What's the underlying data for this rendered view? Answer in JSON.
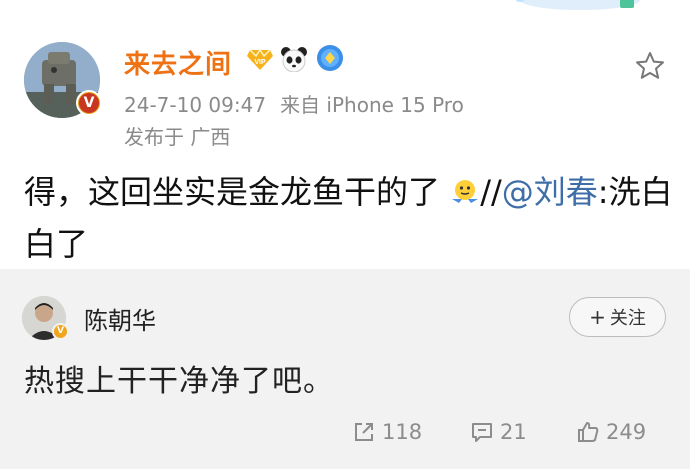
{
  "post": {
    "username": "来去之间",
    "timestamp": "24-7-10 09:47",
    "source": "来自 iPhone 15 Pro",
    "location": "发布于 广西",
    "text_main": "得，这回坐实是金龙鱼干的了",
    "text_slashes": "//",
    "mention": "@刘春",
    "text_tail": ":洗白白了",
    "emoji": "shrug-face-icon"
  },
  "repost": {
    "username": "陈朝华",
    "follow_label": "关注",
    "follow_plus": "+",
    "text": "热搜上干干净净了吧。",
    "repost_count": "118",
    "comment_count": "21",
    "like_count": "249"
  },
  "colors": {
    "username": "#ee7214",
    "mention": "#3e6ea8",
    "meta": "#8a8a8a",
    "repost_bg": "#f2f2f2"
  }
}
